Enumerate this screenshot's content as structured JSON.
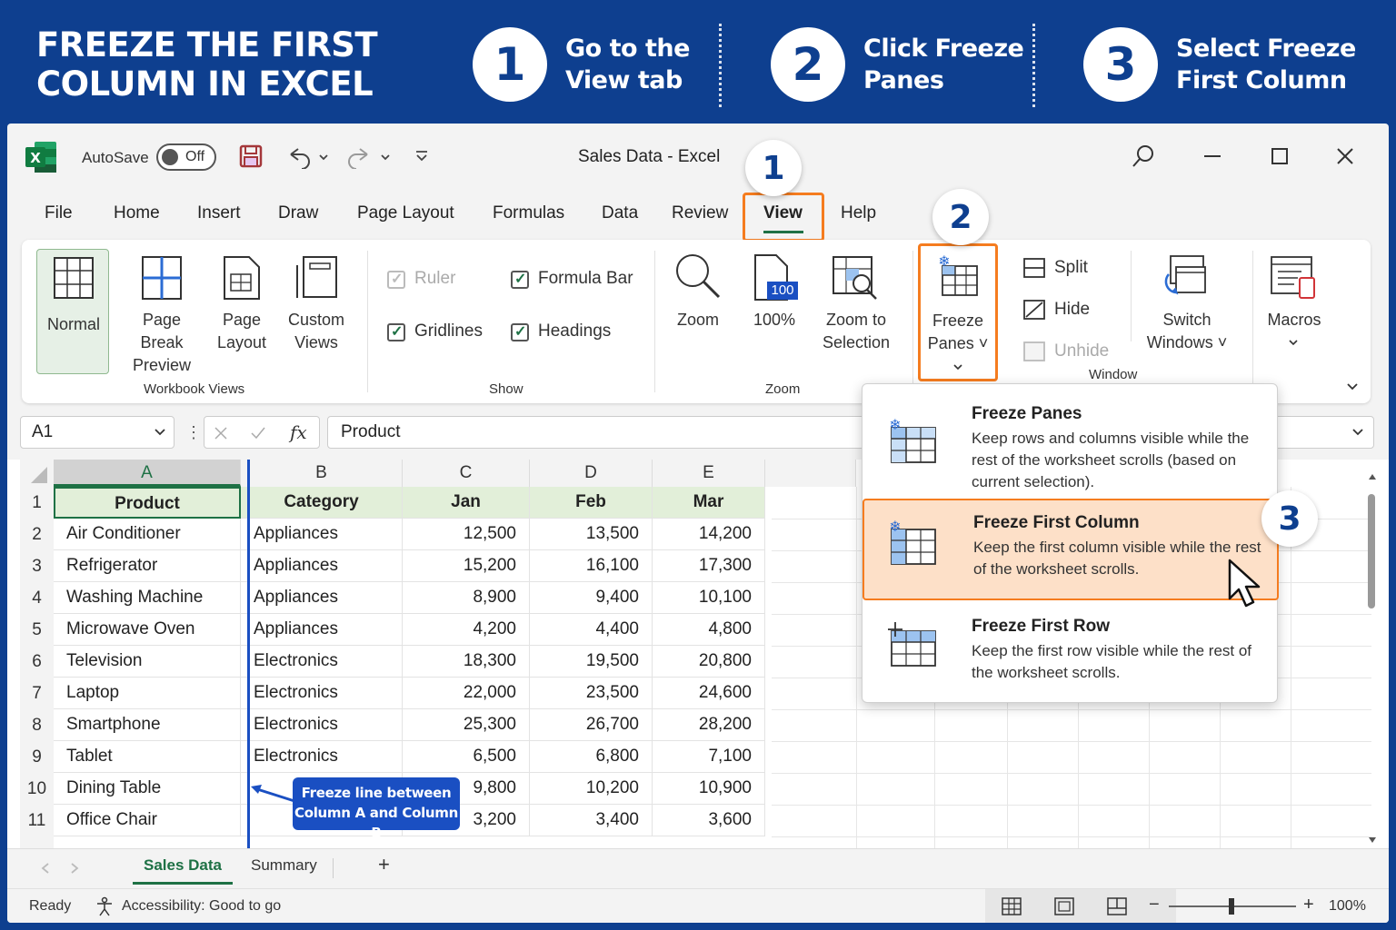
{
  "banner": {
    "title": "FREEZE THE FIRST\nCOLUMN IN EXCEL",
    "steps": [
      {
        "num": "1",
        "text": "Go to the\nView tab"
      },
      {
        "num": "2",
        "text": "Click Freeze\nPanes"
      },
      {
        "num": "3",
        "text": "Select Freeze\nFirst Column"
      }
    ]
  },
  "titlebar": {
    "autosave_label": "AutoSave",
    "autosave_state": "Off",
    "doc_title": "Sales Data  -  Excel"
  },
  "callouts": {
    "one": "1",
    "two": "2",
    "three": "3"
  },
  "menu_tabs": [
    "File",
    "Home",
    "Insert",
    "Draw",
    "Page Layout",
    "Formulas",
    "Data",
    "Review",
    "View",
    "Help"
  ],
  "ribbon": {
    "workbook_views": {
      "label": "Workbook Views",
      "normal": "Normal",
      "page_break": "Page\nBreak\nPreview",
      "page_layout": "Page\nLayout",
      "custom_views": "Custom\nViews"
    },
    "show": {
      "label": "Show",
      "ruler": "Ruler",
      "formula_bar": "Formula Bar",
      "gridlines": "Gridlines",
      "headings": "Headings"
    },
    "zoom": {
      "label": "Zoom",
      "zoom": "Zoom",
      "hundred": "100%",
      "hundred_badge": "100",
      "zoom_to_selection": "Zoom to\nSelection"
    },
    "window": {
      "label": "Window",
      "freeze_panes": "Freeze\nPanes ˅",
      "split": "Split",
      "hide": "Hide",
      "unhide": "Unhide",
      "switch_windows": "Switch\nWindows ˅"
    },
    "macros": {
      "macros": "Macros"
    }
  },
  "formula_bar": {
    "name_box": "A1",
    "fx": "fx",
    "value": "Product"
  },
  "grid": {
    "columns": [
      "A",
      "B",
      "C",
      "D",
      "E"
    ],
    "header_row": [
      "Product",
      "Category",
      "Jan",
      "Feb",
      "Mar"
    ],
    "rows": [
      {
        "n": "2",
        "cells": [
          "Air Conditioner",
          "Appliances",
          "12,500",
          "13,500",
          "14,200"
        ]
      },
      {
        "n": "3",
        "cells": [
          "Refrigerator",
          "Appliances",
          "15,200",
          "16,100",
          "17,300"
        ]
      },
      {
        "n": "4",
        "cells": [
          "Washing Machine",
          "Appliances",
          "8,900",
          "9,400",
          "10,100"
        ]
      },
      {
        "n": "5",
        "cells": [
          "Microwave Oven",
          "Appliances",
          "4,200",
          "4,400",
          "4,800"
        ]
      },
      {
        "n": "6",
        "cells": [
          "Television",
          "Electronics",
          "18,300",
          "19,500",
          "20,800"
        ]
      },
      {
        "n": "7",
        "cells": [
          "Laptop",
          "Electronics",
          "22,000",
          "23,500",
          "24,600"
        ]
      },
      {
        "n": "8",
        "cells": [
          "Smartphone",
          "Electronics",
          "25,300",
          "26,700",
          "28,200"
        ]
      },
      {
        "n": "9",
        "cells": [
          "Tablet",
          "Electronics",
          "6,500",
          "6,800",
          "7,100"
        ]
      },
      {
        "n": "10",
        "cells": [
          "Dining Table",
          "",
          "9,800",
          "10,200",
          "10,900"
        ]
      },
      {
        "n": "11",
        "cells": [
          "Office Chair",
          "",
          "3,200",
          "3,400",
          "3,600"
        ]
      }
    ],
    "row1_num": "1",
    "freeze_note": "Freeze line between\nColumn A and Column B"
  },
  "dropdown": {
    "items": [
      {
        "title": "Freeze Panes",
        "desc": "Keep rows and columns visible while the rest of the worksheet scrolls (based on current selection)."
      },
      {
        "title": "Freeze First Column",
        "desc": "Keep the first column visible while the rest of the worksheet scrolls."
      },
      {
        "title": "Freeze First Row",
        "desc": "Keep the first row visible while the rest of the worksheet scrolls."
      }
    ]
  },
  "sheets": {
    "active": "Sales Data",
    "other": "Summary",
    "add": "+"
  },
  "status": {
    "ready": "Ready",
    "accessibility": "Accessibility: Good to go",
    "zoom": "100%"
  },
  "colors": {
    "banner_bg": "#0e3f8f",
    "excel_green": "#1e7145",
    "highlight_orange": "#f57c1f",
    "selected_bg": "#fde0c8",
    "freeze_line": "#1a4fc2",
    "header_fill": "#e2efd9"
  }
}
